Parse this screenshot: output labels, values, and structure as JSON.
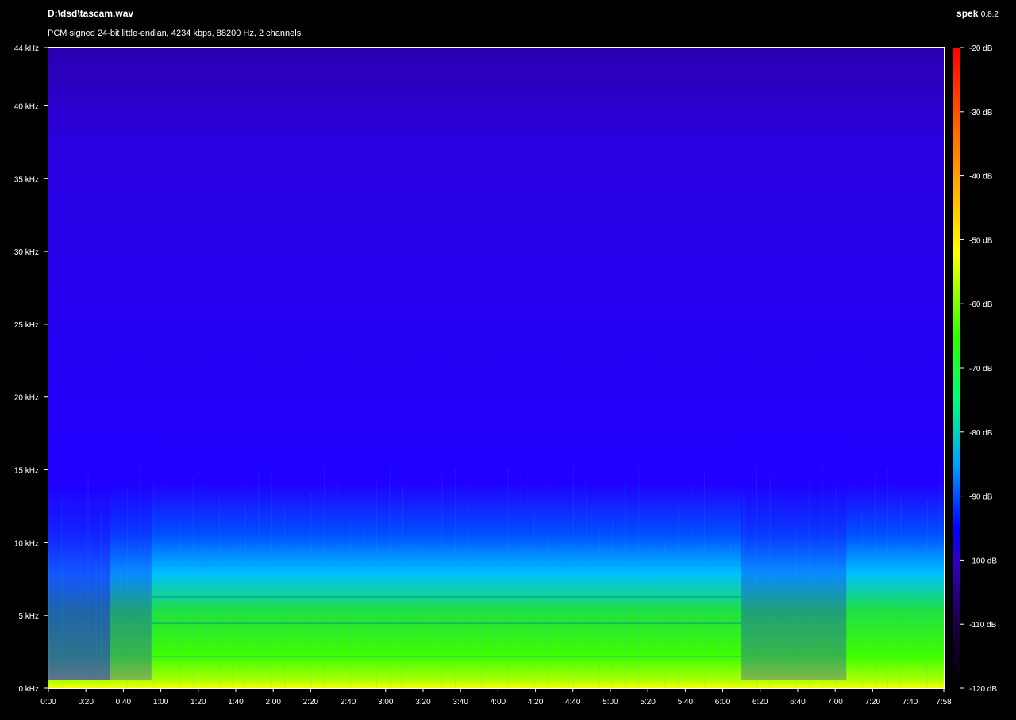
{
  "header": {
    "file_path": "D:\\dsd\\tascam.wav",
    "stream_info": "PCM signed 24-bit little-endian, 4234 kbps, 88200 Hz, 2 channels",
    "app_name": "spek",
    "app_version": "0.8.2"
  },
  "chart_data": {
    "type": "heatmap",
    "title": "",
    "xlabel": "",
    "ylabel": "",
    "x_range_seconds": [
      0,
      478
    ],
    "x_ticks": [
      "0:00",
      "0:20",
      "0:40",
      "1:00",
      "1:20",
      "1:40",
      "2:00",
      "2:20",
      "2:40",
      "3:00",
      "3:20",
      "3:40",
      "4:00",
      "4:20",
      "4:40",
      "5:00",
      "5:20",
      "5:40",
      "6:00",
      "6:20",
      "6:40",
      "7:00",
      "7:20",
      "7:40",
      "7:58"
    ],
    "y_range_khz": [
      0,
      44
    ],
    "y_ticks": [
      "0 kHz",
      "5 kHz",
      "10 kHz",
      "15 kHz",
      "20 kHz",
      "25 kHz",
      "30 kHz",
      "35 kHz",
      "40 kHz",
      "44 kHz"
    ],
    "colorbar_range_db": [
      -120,
      -20
    ],
    "colorbar_ticks": [
      "-20 dB",
      "-30 dB",
      "-40 dB",
      "-50 dB",
      "-60 dB",
      "-70 dB",
      "-80 dB",
      "-90 dB",
      "-100 dB",
      "-110 dB",
      "-120 dB"
    ],
    "colormap": [
      "#000000",
      "#1a0040",
      "#2a00a0",
      "#2000ff",
      "#0060ff",
      "#00c0ff",
      "#00ff80",
      "#30ff00",
      "#c0ff00",
      "#ffff00",
      "#ff9000",
      "#ff0000"
    ],
    "bright_regions_minutes": [
      {
        "start": "0:00",
        "end": "0:33",
        "level": "low"
      },
      {
        "start": "0:33",
        "end": "0:55",
        "level": "medium"
      },
      {
        "start": "0:55",
        "end": "6:10",
        "level": "high"
      },
      {
        "start": "6:10",
        "end": "7:06",
        "level": "medium"
      },
      {
        "start": "7:06",
        "end": "7:58",
        "level": "high"
      }
    ]
  },
  "colors": {
    "background": "#000000",
    "text": "#ffffff",
    "spectrogram_base": "#2000ff"
  }
}
